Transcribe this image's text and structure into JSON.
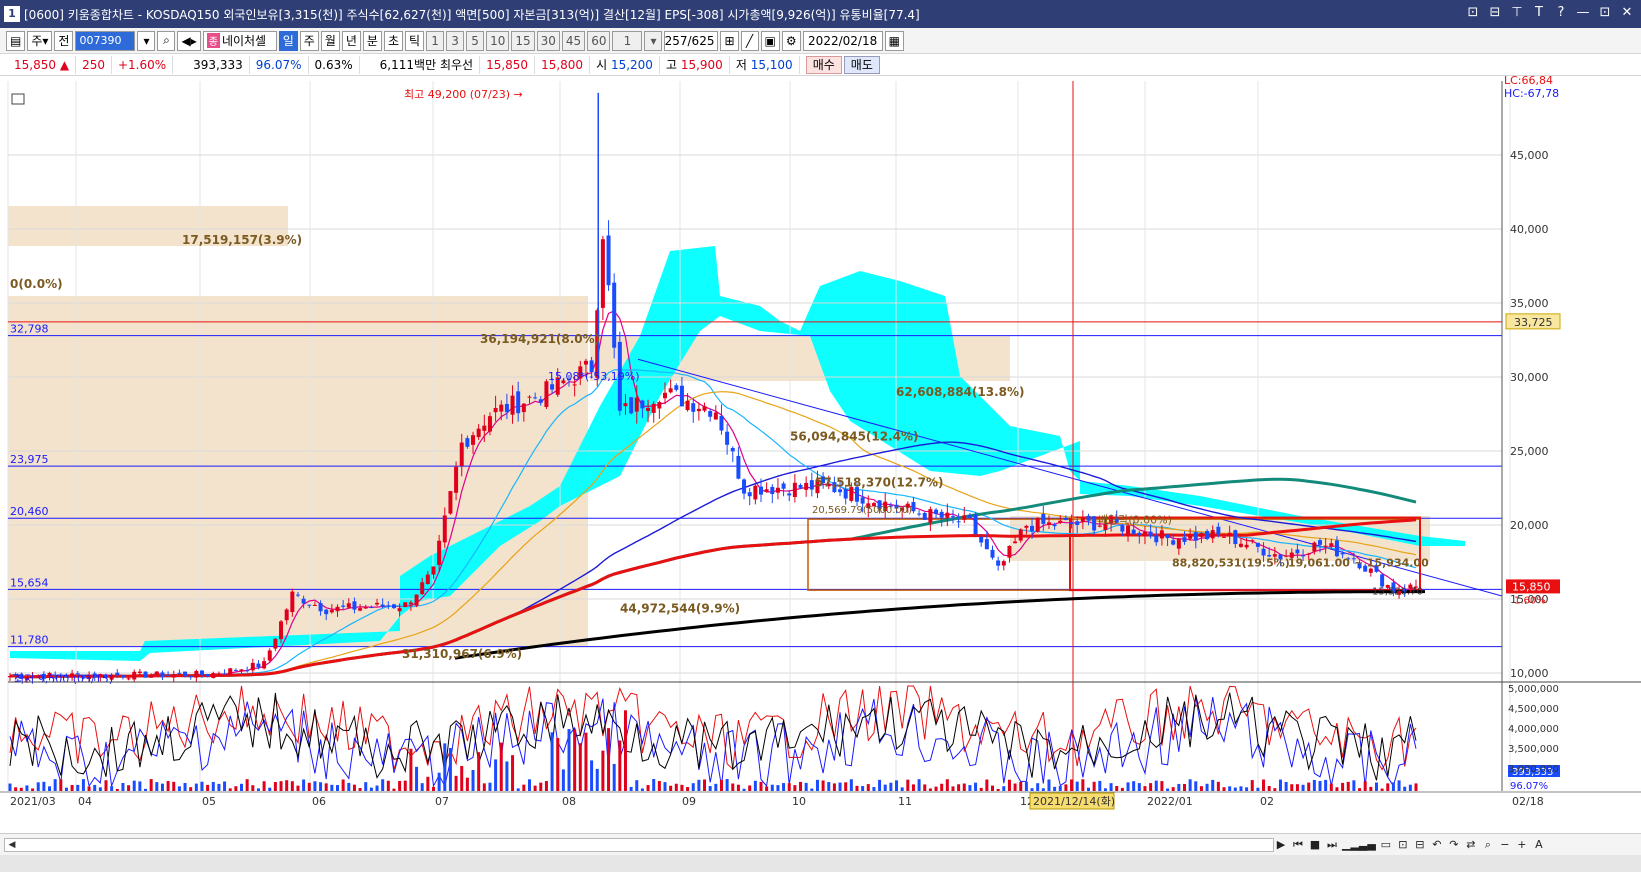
{
  "window": {
    "number": "1",
    "title": "[0600] 키움종합차트 - KOSDAQ150 외국인보유[3,315(천)] 주식수[62,627(천)] 액면[500] 자본금[313(억)] 결산[12월] EPS[-308] 시가총액[9,926(억)] 유통비율[77.4]",
    "buttons": [
      "⊡",
      "⊟",
      "⊤",
      "T",
      "?",
      "—",
      "⊡",
      "✕"
    ]
  },
  "toolbar": {
    "period_type": "주",
    "prev_label": "전",
    "stock_code": "007390",
    "stock_name": "네이처셀",
    "stock_name_badge": "종",
    "period_tabs": [
      "일",
      "주",
      "월",
      "년",
      "분",
      "초",
      "틱"
    ],
    "active_period": "일",
    "minute_options": [
      "1",
      "3",
      "5",
      "10",
      "15",
      "30",
      "45",
      "60"
    ],
    "interval_value": "1",
    "count": "257/625",
    "date": "2022/02/18"
  },
  "quote": {
    "price": "15,850",
    "direction": "▲",
    "change": "250",
    "change_pct": "+1.60%",
    "volume": "393,333",
    "ratio1": "96.07%",
    "ratio2": "0.63%",
    "amount": "6,111백만",
    "best_label": "최우선",
    "best_ask": "15,850",
    "best_bid": "15,800",
    "open_label": "시",
    "open": "15,200",
    "high_label": "고",
    "high": "15,900",
    "low_label": "저",
    "low": "15,100",
    "buy_label": "매수",
    "sell_label": "매도"
  },
  "chart": {
    "lc_label": "LC:66,84",
    "hc_label": "HC:-67,78",
    "y_ticks": [
      {
        "label": "45,000",
        "value": 45000
      },
      {
        "label": "40,000",
        "value": 40000
      },
      {
        "label": "35,000",
        "value": 35000
      },
      {
        "label": "30,000",
        "value": 30000
      },
      {
        "label": "25,000",
        "value": 25000
      },
      {
        "label": "20,000",
        "value": 20000
      },
      {
        "label": "15,000",
        "value": 15000
      },
      {
        "label": "10,000",
        "value": 10000
      }
    ],
    "h_levels": [
      {
        "label": "32,798",
        "value": 32798,
        "color": "#1a1aff"
      },
      {
        "label": "23,975",
        "value": 23975,
        "color": "#1a1aff"
      },
      {
        "label": "20,460",
        "value": 20460,
        "color": "#1a1aff"
      },
      {
        "label": "15,654",
        "value": 15654,
        "color": "#1a1aff"
      },
      {
        "label": "11,780",
        "value": 11780,
        "color": "#1a1aff"
      }
    ],
    "red_level": {
      "label": "33,725",
      "value": 33725
    },
    "price_badge": "15,850",
    "price_badge_pct": "1.60%",
    "high_annotation": "최고 49,200 (07/23)",
    "low_annotation": "최저 9,500 (03/15)",
    "vp_labels": [
      {
        "text": "17,519,157(3.9%)",
        "price": 39000
      },
      {
        "text": "0(0.0%)",
        "price": 36000
      },
      {
        "text": "36,194,921(8.0%)",
        "price": 32300
      },
      {
        "text": "62,608,884(13.8%)",
        "price": 28700
      },
      {
        "text": "56,094,845(12.4%)",
        "price": 25700
      },
      {
        "text": "57,518,370(12.7%)",
        "price": 22600
      },
      {
        "text": "44,972,544(9.9%)",
        "price": 14100
      },
      {
        "text": "31,310,967(6.9%)",
        "price": 11000
      }
    ],
    "trend_label": "15,08*(-53,19%)",
    "ex_dividend_label": "배당락(0.00%)",
    "box_label": "20,569.79(5000.00)",
    "range_label": "88,820,531(19.5%)",
    "range_text": "19,061.00 ~ 15,934.00",
    "min_label": "15,520.70",
    "crosshair_date": "2021/12/14(화)",
    "x_labels": [
      "2021/03",
      "04",
      "05",
      "06",
      "07",
      "08",
      "09",
      "10",
      "11",
      "12",
      "2022/01",
      "02",
      "02/18"
    ],
    "osc_ticks": [
      "5,000,000",
      "4,500,000",
      "4,000,000",
      "3,500,000",
      "3,000,000"
    ],
    "osc_volume_badge": "393,333",
    "osc_pct_badge": "96.07%",
    "colors": {
      "up": "#e0001c",
      "down": "#1a4cff",
      "cloud": "#00ffff",
      "ma5": "#e0008a",
      "ma20": "#19b5ff",
      "ma60": "#e8a316",
      "ma120": "#1b1bd9",
      "ma240": "#138a7a",
      "ma_long": "#e81010",
      "ma_long2": "#000000",
      "vp": "#f3e3cc"
    }
  }
}
